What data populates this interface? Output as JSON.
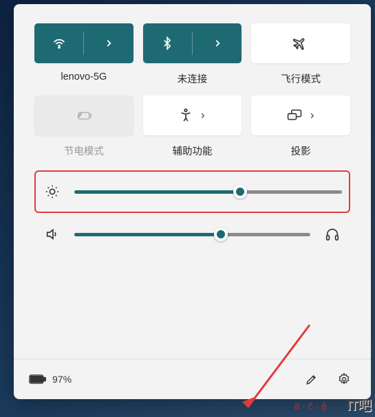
{
  "tiles": [
    {
      "id": "wifi",
      "label": "lenovo-5G",
      "state": "on",
      "split": true,
      "icon": "wifi"
    },
    {
      "id": "bluetooth",
      "label": "未连接",
      "state": "on",
      "split": true,
      "icon": "bluetooth"
    },
    {
      "id": "airplane",
      "label": "飞行模式",
      "state": "off",
      "split": false,
      "icon": "airplane"
    },
    {
      "id": "battery-saver",
      "label": "节电模式",
      "state": "disabled",
      "split": false,
      "icon": "leaf-battery"
    },
    {
      "id": "accessibility",
      "label": "辅助功能",
      "state": "off",
      "split": false,
      "icon": "accessibility",
      "chevron": true
    },
    {
      "id": "project",
      "label": "投影",
      "state": "off",
      "split": false,
      "icon": "project",
      "chevron": true
    }
  ],
  "sliders": {
    "brightness": {
      "value": 62,
      "highlighted": true
    },
    "volume": {
      "value": 62,
      "highlighted": false
    }
  },
  "footer": {
    "battery_percent": "97%"
  },
  "watermark": "IT吧",
  "diacritics": "ä · č · ę̌"
}
